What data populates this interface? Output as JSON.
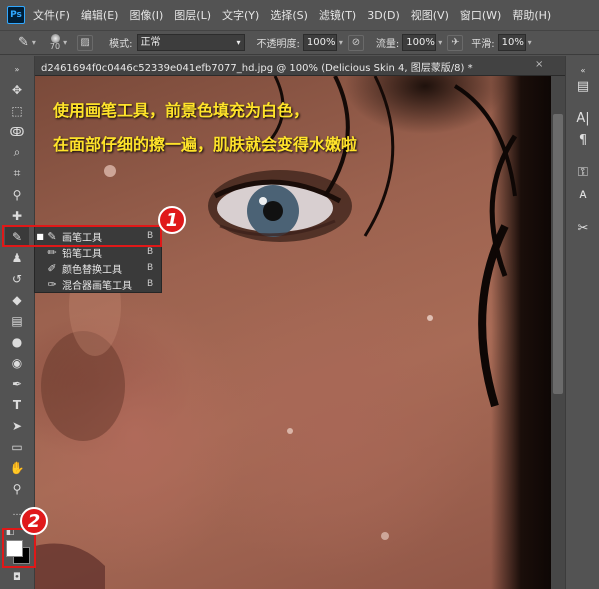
{
  "app": {
    "logo_text": "Ps"
  },
  "menu": [
    "文件(F)",
    "编辑(E)",
    "图像(I)",
    "图层(L)",
    "文字(Y)",
    "选择(S)",
    "滤镜(T)",
    "3D(D)",
    "视图(V)",
    "窗口(W)",
    "帮助(H)"
  ],
  "options": {
    "brush_size": "70",
    "mode_label": "模式:",
    "mode_value": "正常",
    "opacity_label": "不透明度:",
    "opacity_value": "100%",
    "flow_label": "流量:",
    "flow_value": "100%",
    "smooth_label": "平滑:",
    "smooth_value": "10%"
  },
  "document": {
    "tab_title": "d2461694f0c0446c52339e041efb7077_hd.jpg @ 100% (Delicious Skin 4, 图层蒙版/8) *",
    "close_glyph": "×"
  },
  "caption": {
    "line1": "使用画笔工具，前景色填充为白色，",
    "line2": "在面部仔细的擦一遍，肌肤就会变得水嫩啦"
  },
  "flyout": {
    "items": [
      {
        "label": "画笔工具",
        "key": "B",
        "icon": "brush-icon",
        "active": true
      },
      {
        "label": "铅笔工具",
        "key": "B",
        "icon": "pencil-icon",
        "active": false
      },
      {
        "label": "颜色替换工具",
        "key": "B",
        "icon": "color-replace-icon",
        "active": false
      },
      {
        "label": "混合器画笔工具",
        "key": "B",
        "icon": "mixer-brush-icon",
        "active": false
      }
    ]
  },
  "badges": {
    "one": "1",
    "two": "2"
  },
  "colors": {
    "foreground": "#ffffff",
    "background": "#000000",
    "highlight": "#e01818",
    "caption": "#ffe32a"
  }
}
